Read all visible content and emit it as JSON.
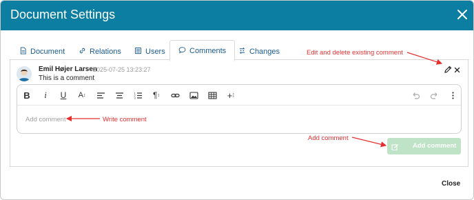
{
  "dialog": {
    "title": "Document Settings"
  },
  "tabs": [
    {
      "label": "Document",
      "icon": "document-icon"
    },
    {
      "label": "Relations",
      "icon": "link-icon"
    },
    {
      "label": "Users",
      "icon": "users-list-icon"
    },
    {
      "label": "Comments",
      "icon": "comment-bubble-icon",
      "active": true
    },
    {
      "label": "Changes",
      "icon": "changes-icon"
    }
  ],
  "comment": {
    "author": "Emil Højer Larsen",
    "timestamp": "2025-07-25 13:23:27",
    "text": "This is a comment"
  },
  "editor": {
    "placeholder": "Add comment",
    "toolbar": [
      "bold-icon",
      "italic-icon",
      "underline-icon",
      "font-size-icon",
      "align-left-icon",
      "align-center-icon",
      "numbered-list-icon",
      "paragraph-icon",
      "link-icon",
      "image-icon",
      "table-icon",
      "insert-more-icon",
      "undo-icon",
      "redo-icon",
      "more-options-icon"
    ]
  },
  "buttons": {
    "add_comment": "Add comment",
    "close": "Close"
  },
  "annotations": {
    "edit_delete": "Edit and delete existing comment",
    "write": "Write comment",
    "add": "Add comment"
  },
  "colors": {
    "header": "#0c7ea1",
    "tab_text": "#1a5a8a",
    "add_button": "#bfe3c6",
    "annotation": "#e53030"
  }
}
